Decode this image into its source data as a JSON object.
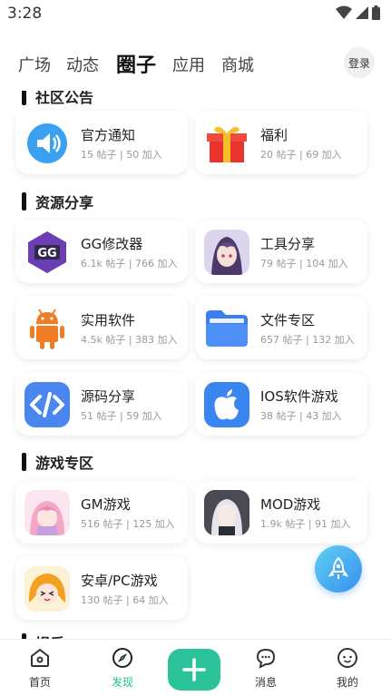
{
  "status_bar": {
    "time": "3:28"
  },
  "top_tabs": [
    {
      "label": "广场"
    },
    {
      "label": "动态"
    },
    {
      "label": "圈子"
    },
    {
      "label": "应用"
    },
    {
      "label": "商城"
    }
  ],
  "login_label": "登录",
  "sections": {
    "top_partial": "社区公告",
    "resources": "资源分享",
    "games": "游戏专区",
    "bottom_partial": "娱乐"
  },
  "cards": {
    "official": {
      "name": "官方通知",
      "meta": "15 帖子 | 50 加入"
    },
    "welfare": {
      "name": "福利",
      "meta": "20 帖子 | 69 加入"
    },
    "gg": {
      "name": "GG修改器",
      "meta": "6.1k 帖子 | 766 加入"
    },
    "tools": {
      "name": "工具分享",
      "meta": "79 帖子 | 104 加入"
    },
    "software": {
      "name": "实用软件",
      "meta": "4.5k 帖子 | 383 加入"
    },
    "files": {
      "name": "文件专区",
      "meta": "657 帖子 | 132 加入"
    },
    "source": {
      "name": "源码分享",
      "meta": "51 帖子 | 59 加入"
    },
    "ios": {
      "name": "IOS软件游戏",
      "meta": "38 帖子 | 43 加入"
    },
    "gm": {
      "name": "GM游戏",
      "meta": "516 帖子 | 125 加入"
    },
    "mod": {
      "name": "MOD游戏",
      "meta": "1.9k 帖子 | 91 加入"
    },
    "pc": {
      "name": "安卓/PC游戏",
      "meta": "130 帖子 | 64 加入"
    }
  },
  "bottom_nav": [
    {
      "label": "首页"
    },
    {
      "label": "发现"
    },
    {
      "label": "消息"
    },
    {
      "label": "我的"
    }
  ],
  "colors": {
    "accent": "#2cc39b",
    "fab": "#3a8ff0"
  }
}
